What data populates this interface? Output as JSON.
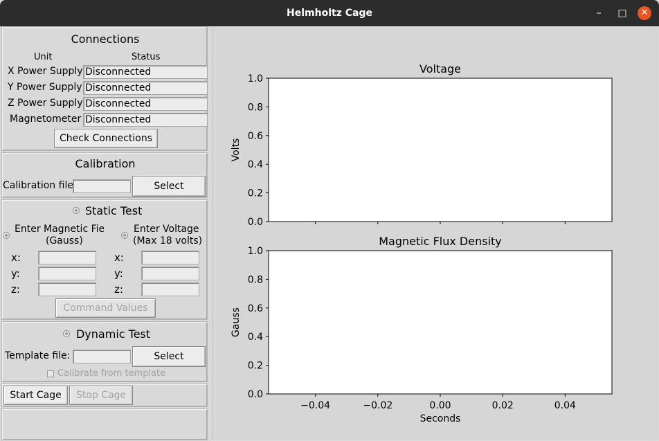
{
  "window": {
    "title": "Helmholtz Cage",
    "controls": {
      "minimize": "–",
      "maximize": "□",
      "close": "✕"
    }
  },
  "connections": {
    "title": "Connections",
    "col_unit": "Unit",
    "col_status": "Status",
    "rows": [
      {
        "unit": "X Power Supply",
        "status": "Disconnected"
      },
      {
        "unit": "Y Power Supply",
        "status": "Disconnected"
      },
      {
        "unit": "Z Power Supply",
        "status": "Disconnected"
      },
      {
        "unit": "Magnetometer",
        "status": "Disconnected"
      }
    ],
    "check_button": "Check Connections"
  },
  "calibration": {
    "title": "Calibration",
    "file_label": "Calibration file:",
    "file_value": "",
    "select_button": "Select"
  },
  "static_test": {
    "title": "Static Test",
    "mag_option_line1": "Enter Magnetic Field",
    "mag_option_line2": "(Gauss)",
    "volt_option_line1": "Enter Voltage",
    "volt_option_line2": "(Max 18 volts)",
    "x_label": "x:",
    "y_label": "y:",
    "z_label": "z:",
    "mag_values": {
      "x": "",
      "y": "",
      "z": ""
    },
    "volt_values": {
      "x": "",
      "y": "",
      "z": ""
    },
    "command_button": "Command Values"
  },
  "dynamic_test": {
    "title": "Dynamic Test",
    "template_label": "Template file:",
    "template_value": "",
    "select_button": "Select",
    "calibrate_label": "Calibrate from template",
    "calibrate_checked": false
  },
  "cage": {
    "start_button": "Start Cage",
    "stop_button": "Stop Cage"
  },
  "chart_data": [
    {
      "type": "line",
      "title": "Voltage",
      "xlabel": "",
      "ylabel": "Volts",
      "series": [],
      "ylim": [
        0.0,
        1.0
      ],
      "yticks": [
        "0.0",
        "0.2",
        "0.4",
        "0.6",
        "0.8",
        "1.0"
      ],
      "xlim": [
        -0.055,
        0.055
      ],
      "xticks": [
        -0.04,
        -0.02,
        0.0,
        0.02,
        0.04
      ],
      "xtick_labels_shown": false,
      "grid": false
    },
    {
      "type": "line",
      "title": "Magnetic Flux Density",
      "xlabel": "Seconds",
      "ylabel": "Gauss",
      "series": [],
      "ylim": [
        0.0,
        1.0
      ],
      "yticks": [
        "0.0",
        "0.2",
        "0.4",
        "0.6",
        "0.8",
        "1.0"
      ],
      "xlim": [
        -0.055,
        0.055
      ],
      "xticks": [
        -0.04,
        -0.02,
        0.0,
        0.02,
        0.04
      ],
      "xtick_labels": [
        "−0.04",
        "−0.02",
        "0.00",
        "0.02",
        "0.04"
      ],
      "xtick_labels_shown": true,
      "grid": false
    }
  ]
}
